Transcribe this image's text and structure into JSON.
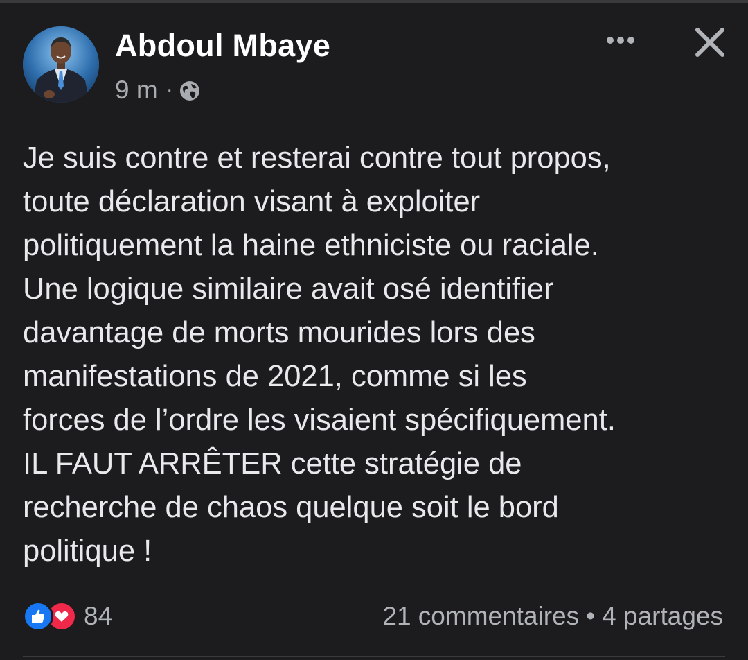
{
  "post": {
    "author": "Abdoul Mbaye",
    "time": "9 m",
    "separator": "·",
    "audience_icon": "globe-icon",
    "text": "Je suis contre et resterai contre tout propos,\ntoute déclaration visant à exploiter\npolitiquement la haine ethniciste ou raciale.\nUne logique similaire avait osé identifier\ndavantage de morts mourides lors des\nmanifestations de 2021, comme si les\nforces de l’ordre les visaient spécifiquement.\nIL FAUT ARRÊTER cette stratégie de\nrecherche de chaos quelque soit le bord\npolitique !",
    "reaction_count": "84",
    "reaction_icons": [
      "like-icon",
      "love-icon"
    ],
    "comments": "21 commentaires",
    "engagement_separator": "•",
    "shares": "4 partages"
  },
  "header": {
    "more_icon": "more-horizontal-icon",
    "close_icon": "close-icon"
  },
  "colors": {
    "background": "#1c1c1e",
    "text_primary": "#e8e9ec",
    "text_secondary": "#b0b3b8",
    "like_blue": "#1877f2",
    "love_red": "#f0284a"
  }
}
